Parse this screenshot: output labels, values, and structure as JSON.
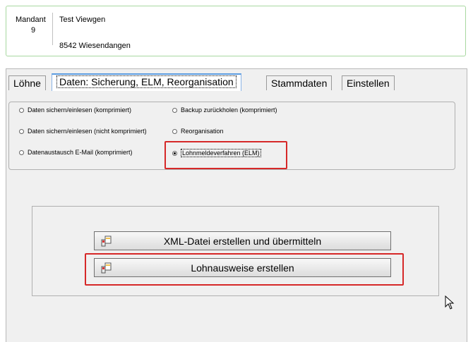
{
  "header": {
    "mandant_label": "Mandant",
    "mandant_number": "9",
    "company_name": "Test Viewgen",
    "company_address": "8542 Wiesendangen"
  },
  "tabs": [
    {
      "label": "Löhne",
      "active": false
    },
    {
      "label": "Daten: Sicherung, ELM, Reorganisation",
      "active": true
    },
    {
      "label": "Stammdaten",
      "active": false
    },
    {
      "label": "Einstellen",
      "active": false
    }
  ],
  "options": [
    {
      "label": "Daten sichern/einlesen (komprimiert)",
      "selected": false
    },
    {
      "label": "Backup zurückholen (komprimiert)",
      "selected": false
    },
    {
      "label": "Daten sichern/einlesen (nicht komprimiert)",
      "selected": false
    },
    {
      "label": "Reorganisation",
      "selected": false
    },
    {
      "label": "Datenaustausch E-Mail (komprimiert)",
      "selected": false
    },
    {
      "label": "Lohnmeldeverfahren (ELM)",
      "selected": true
    }
  ],
  "actions": {
    "xml_button": "XML-Datei erstellen und übermitteln",
    "lohnausweise_button": "Lohnausweise erstellen"
  },
  "colors": {
    "highlight": "#d62828",
    "header_border": "#a8d8a0",
    "active_tab": "#5a9be0"
  }
}
